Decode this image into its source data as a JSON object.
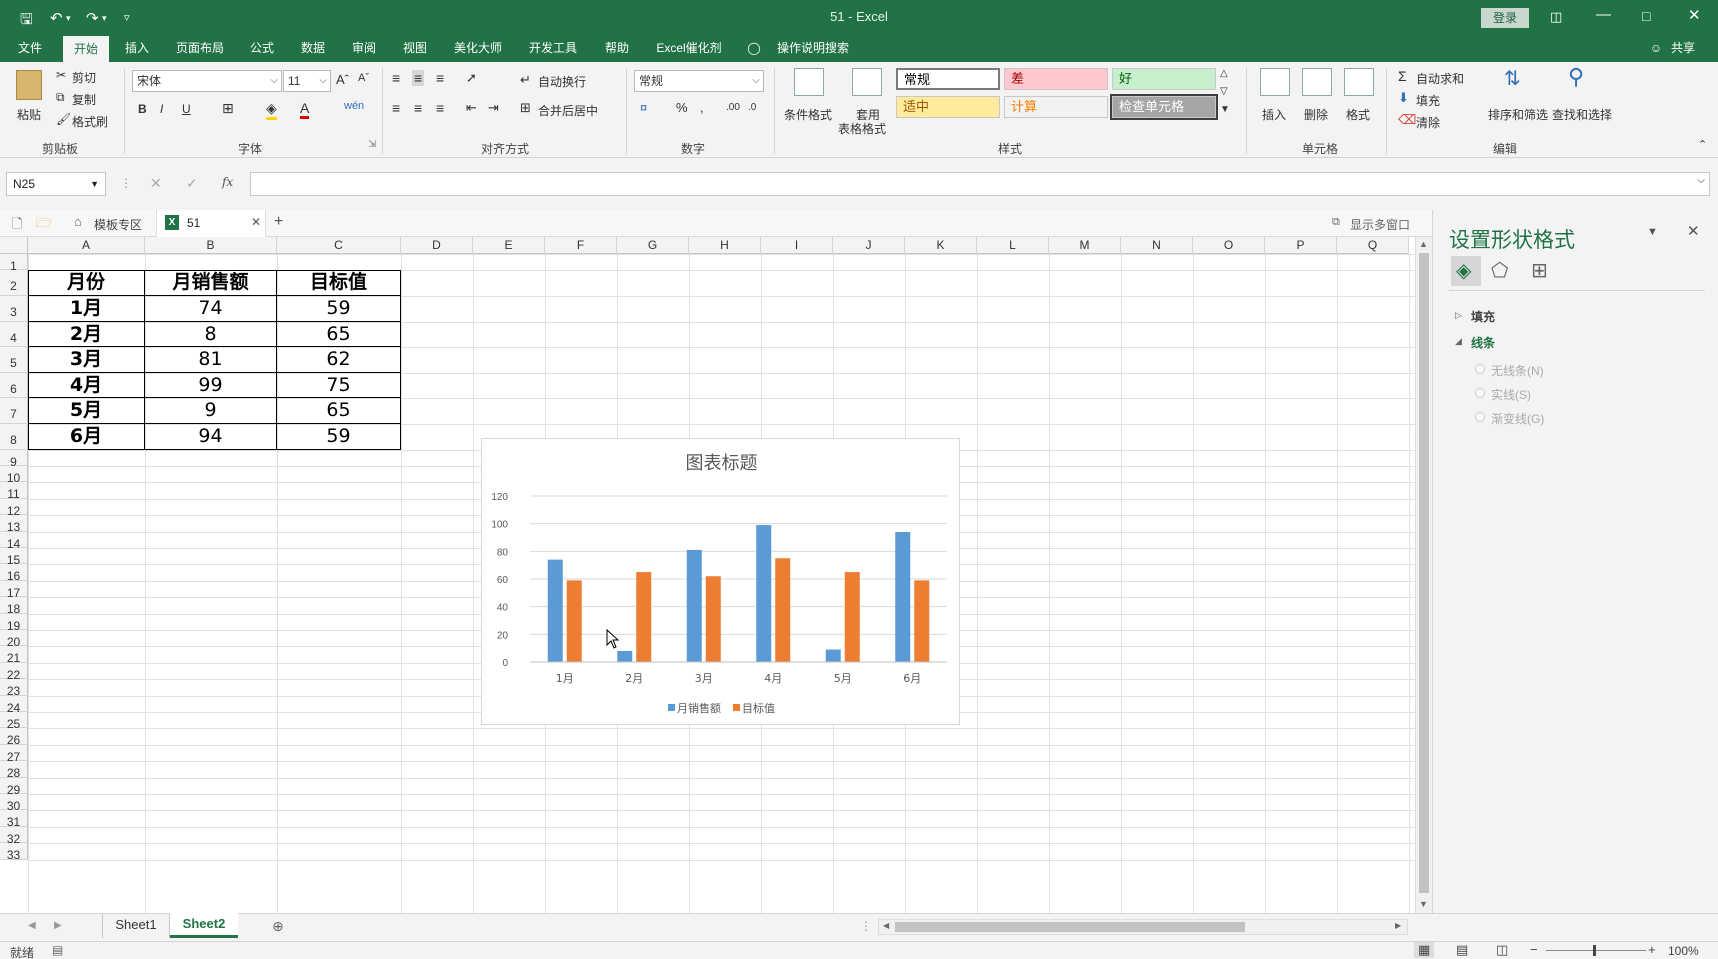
{
  "titlebar": {
    "title": "51  -  Excel",
    "login": "登录",
    "quick_access": [
      "save-icon",
      "undo-icon",
      "redo-icon",
      "customize-icon"
    ]
  },
  "tabs": [
    "文件",
    "开始",
    "插入",
    "页面布局",
    "公式",
    "数据",
    "审阅",
    "视图",
    "美化大师",
    "开发工具",
    "帮助",
    "Excel催化剂"
  ],
  "tell_me": "操作说明搜索",
  "share": "共享",
  "ribbon": {
    "clipboard": {
      "paste": "粘贴",
      "cut": "剪切",
      "copy": "复制",
      "format_painter": "格式刷",
      "label": "剪贴板"
    },
    "font": {
      "name": "宋体",
      "size": "11",
      "label": "字体"
    },
    "alignment": {
      "wrap": "自动换行",
      "merge": "合并后居中",
      "label": "对齐方式"
    },
    "number": {
      "format": "常规",
      "label": "数字"
    },
    "styles": {
      "conditional": "条件格式",
      "table_format_1": "套用",
      "table_format_2": "表格格式",
      "cells": [
        {
          "text": "常规",
          "bg": "#ffffff",
          "fg": "#000000"
        },
        {
          "text": "差",
          "bg": "#ffc7ce",
          "fg": "#9c0006"
        },
        {
          "text": "好",
          "bg": "#c6efce",
          "fg": "#006100"
        },
        {
          "text": "适中",
          "bg": "#ffeb9c",
          "fg": "#9c5700"
        },
        {
          "text": "计算",
          "bg": "#f2f2f2",
          "fg": "#fa7d00"
        },
        {
          "text": "检查单元格",
          "bg": "#a5a5a5",
          "fg": "#ffffff"
        }
      ],
      "label": "样式"
    },
    "cells": {
      "insert": "插入",
      "delete": "删除",
      "format": "格式",
      "label": "单元格"
    },
    "editing": {
      "autosum": "自动求和",
      "fill": "填充",
      "clear": "清除",
      "sort": "排序和筛选",
      "find": "查找和选择",
      "label": "编辑"
    }
  },
  "formula_bar": {
    "name_box": "N25",
    "value": ""
  },
  "doc_tabs": {
    "template": "模板专区",
    "file": "51",
    "multi_window": "显示多窗口"
  },
  "columns": [
    "A",
    "B",
    "C",
    "D",
    "E",
    "F",
    "G",
    "H",
    "I",
    "J",
    "K",
    "L",
    "M",
    "N",
    "O",
    "P",
    "Q"
  ],
  "rows": [
    "1",
    "2",
    "3",
    "4",
    "5",
    "6",
    "7",
    "8",
    "9",
    "10",
    "11",
    "12",
    "13",
    "14",
    "15",
    "16",
    "17",
    "18",
    "19",
    "20",
    "21",
    "22",
    "23",
    "24",
    "25",
    "26",
    "27",
    "28",
    "29",
    "30",
    "31",
    "32",
    "33"
  ],
  "table": {
    "headers": [
      "月份",
      "月销售额",
      "目标值"
    ],
    "rows": [
      [
        "1月",
        "74",
        "59"
      ],
      [
        "2月",
        "8",
        "65"
      ],
      [
        "3月",
        "81",
        "62"
      ],
      [
        "4月",
        "99",
        "75"
      ],
      [
        "5月",
        "9",
        "65"
      ],
      [
        "6月",
        "94",
        "59"
      ]
    ]
  },
  "chart_data": {
    "type": "bar",
    "title": "图表标题",
    "categories": [
      "1月",
      "2月",
      "3月",
      "4月",
      "5月",
      "6月"
    ],
    "series": [
      {
        "name": "月销售额",
        "values": [
          74,
          8,
          81,
          99,
          9,
          94
        ],
        "color": "#5b9bd5"
      },
      {
        "name": "目标值",
        "values": [
          59,
          65,
          62,
          75,
          65,
          59
        ],
        "color": "#ed7d31"
      }
    ],
    "ylim": [
      0,
      120
    ],
    "yticks": [
      "0",
      "20",
      "40",
      "60",
      "80",
      "100",
      "120"
    ],
    "grid": true,
    "legend": "bottom"
  },
  "pane": {
    "title": "设置形状格式",
    "sections": [
      {
        "label": "填充",
        "expanded": false
      },
      {
        "label": "线条",
        "expanded": true
      }
    ],
    "options": [
      "无线条(N)",
      "实线(S)",
      "渐变线(G)"
    ]
  },
  "sheets": {
    "tabs": [
      "Sheet1",
      "Sheet2"
    ],
    "active": "Sheet2"
  },
  "status": {
    "ready": "就绪",
    "zoom": "100%"
  }
}
